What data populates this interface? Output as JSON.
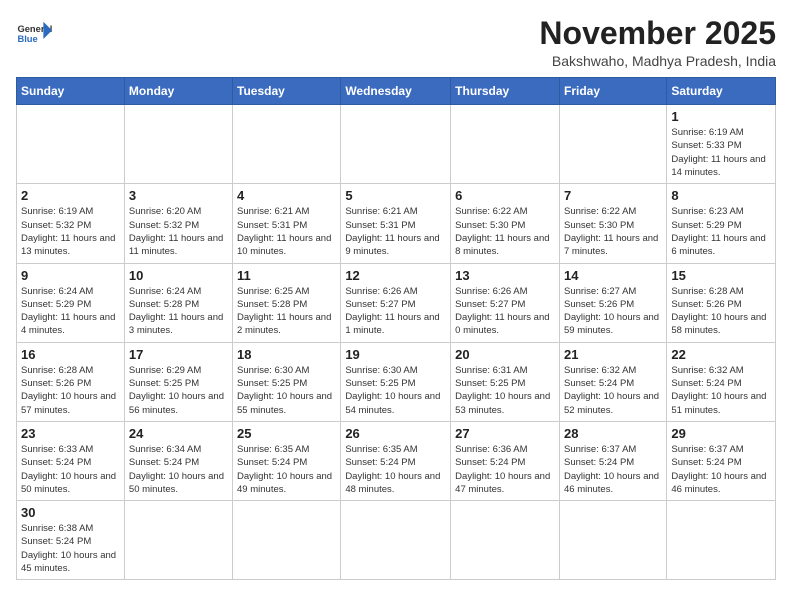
{
  "header": {
    "logo_general": "General",
    "logo_blue": "Blue",
    "month_title": "November 2025",
    "subtitle": "Bakshwaho, Madhya Pradesh, India"
  },
  "days_of_week": [
    "Sunday",
    "Monday",
    "Tuesday",
    "Wednesday",
    "Thursday",
    "Friday",
    "Saturday"
  ],
  "weeks": [
    [
      {
        "day": "",
        "info": ""
      },
      {
        "day": "",
        "info": ""
      },
      {
        "day": "",
        "info": ""
      },
      {
        "day": "",
        "info": ""
      },
      {
        "day": "",
        "info": ""
      },
      {
        "day": "",
        "info": ""
      },
      {
        "day": "1",
        "info": "Sunrise: 6:19 AM\nSunset: 5:33 PM\nDaylight: 11 hours and 14 minutes."
      }
    ],
    [
      {
        "day": "2",
        "info": "Sunrise: 6:19 AM\nSunset: 5:32 PM\nDaylight: 11 hours and 13 minutes."
      },
      {
        "day": "3",
        "info": "Sunrise: 6:20 AM\nSunset: 5:32 PM\nDaylight: 11 hours and 11 minutes."
      },
      {
        "day": "4",
        "info": "Sunrise: 6:21 AM\nSunset: 5:31 PM\nDaylight: 11 hours and 10 minutes."
      },
      {
        "day": "5",
        "info": "Sunrise: 6:21 AM\nSunset: 5:31 PM\nDaylight: 11 hours and 9 minutes."
      },
      {
        "day": "6",
        "info": "Sunrise: 6:22 AM\nSunset: 5:30 PM\nDaylight: 11 hours and 8 minutes."
      },
      {
        "day": "7",
        "info": "Sunrise: 6:22 AM\nSunset: 5:30 PM\nDaylight: 11 hours and 7 minutes."
      },
      {
        "day": "8",
        "info": "Sunrise: 6:23 AM\nSunset: 5:29 PM\nDaylight: 11 hours and 6 minutes."
      }
    ],
    [
      {
        "day": "9",
        "info": "Sunrise: 6:24 AM\nSunset: 5:29 PM\nDaylight: 11 hours and 4 minutes."
      },
      {
        "day": "10",
        "info": "Sunrise: 6:24 AM\nSunset: 5:28 PM\nDaylight: 11 hours and 3 minutes."
      },
      {
        "day": "11",
        "info": "Sunrise: 6:25 AM\nSunset: 5:28 PM\nDaylight: 11 hours and 2 minutes."
      },
      {
        "day": "12",
        "info": "Sunrise: 6:26 AM\nSunset: 5:27 PM\nDaylight: 11 hours and 1 minute."
      },
      {
        "day": "13",
        "info": "Sunrise: 6:26 AM\nSunset: 5:27 PM\nDaylight: 11 hours and 0 minutes."
      },
      {
        "day": "14",
        "info": "Sunrise: 6:27 AM\nSunset: 5:26 PM\nDaylight: 10 hours and 59 minutes."
      },
      {
        "day": "15",
        "info": "Sunrise: 6:28 AM\nSunset: 5:26 PM\nDaylight: 10 hours and 58 minutes."
      }
    ],
    [
      {
        "day": "16",
        "info": "Sunrise: 6:28 AM\nSunset: 5:26 PM\nDaylight: 10 hours and 57 minutes."
      },
      {
        "day": "17",
        "info": "Sunrise: 6:29 AM\nSunset: 5:25 PM\nDaylight: 10 hours and 56 minutes."
      },
      {
        "day": "18",
        "info": "Sunrise: 6:30 AM\nSunset: 5:25 PM\nDaylight: 10 hours and 55 minutes."
      },
      {
        "day": "19",
        "info": "Sunrise: 6:30 AM\nSunset: 5:25 PM\nDaylight: 10 hours and 54 minutes."
      },
      {
        "day": "20",
        "info": "Sunrise: 6:31 AM\nSunset: 5:25 PM\nDaylight: 10 hours and 53 minutes."
      },
      {
        "day": "21",
        "info": "Sunrise: 6:32 AM\nSunset: 5:24 PM\nDaylight: 10 hours and 52 minutes."
      },
      {
        "day": "22",
        "info": "Sunrise: 6:32 AM\nSunset: 5:24 PM\nDaylight: 10 hours and 51 minutes."
      }
    ],
    [
      {
        "day": "23",
        "info": "Sunrise: 6:33 AM\nSunset: 5:24 PM\nDaylight: 10 hours and 50 minutes."
      },
      {
        "day": "24",
        "info": "Sunrise: 6:34 AM\nSunset: 5:24 PM\nDaylight: 10 hours and 50 minutes."
      },
      {
        "day": "25",
        "info": "Sunrise: 6:35 AM\nSunset: 5:24 PM\nDaylight: 10 hours and 49 minutes."
      },
      {
        "day": "26",
        "info": "Sunrise: 6:35 AM\nSunset: 5:24 PM\nDaylight: 10 hours and 48 minutes."
      },
      {
        "day": "27",
        "info": "Sunrise: 6:36 AM\nSunset: 5:24 PM\nDaylight: 10 hours and 47 minutes."
      },
      {
        "day": "28",
        "info": "Sunrise: 6:37 AM\nSunset: 5:24 PM\nDaylight: 10 hours and 46 minutes."
      },
      {
        "day": "29",
        "info": "Sunrise: 6:37 AM\nSunset: 5:24 PM\nDaylight: 10 hours and 46 minutes."
      }
    ],
    [
      {
        "day": "30",
        "info": "Sunrise: 6:38 AM\nSunset: 5:24 PM\nDaylight: 10 hours and 45 minutes."
      },
      {
        "day": "",
        "info": ""
      },
      {
        "day": "",
        "info": ""
      },
      {
        "day": "",
        "info": ""
      },
      {
        "day": "",
        "info": ""
      },
      {
        "day": "",
        "info": ""
      },
      {
        "day": "",
        "info": ""
      }
    ]
  ]
}
